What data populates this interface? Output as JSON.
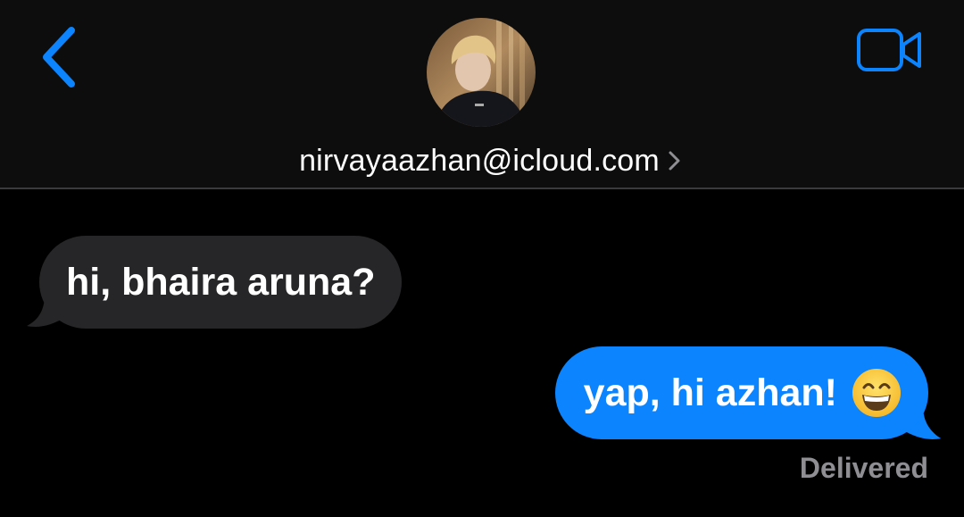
{
  "header": {
    "contact_email": "nirvayaazhan@icloud.com",
    "back_icon": "chevron-left-icon",
    "video_icon": "video-camera-icon",
    "accent_color": "#0b84fe"
  },
  "messages": [
    {
      "direction": "incoming",
      "text": "hi, bhaira aruna?"
    },
    {
      "direction": "outgoing",
      "text": "yap, hi azhan!",
      "emoji": "grinning-face-with-smiling-eyes"
    }
  ],
  "status": {
    "delivery": "Delivered"
  },
  "colors": {
    "background": "#000000",
    "incoming_bubble": "#262628",
    "outgoing_bubble": "#0b84fe",
    "status_text": "#8e8e93"
  }
}
